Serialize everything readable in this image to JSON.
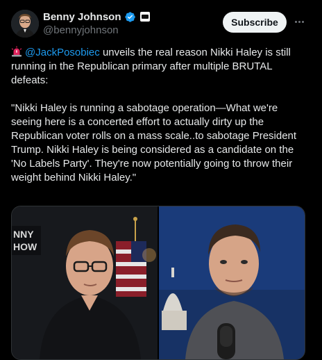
{
  "author": {
    "display_name": "Benny Johnson",
    "handle": "@bennyjohnson",
    "verified": true,
    "avatar_icon": "avatar-photo"
  },
  "header": {
    "subscribe_label": "Subscribe",
    "more_icon": "more-dots-icon"
  },
  "tweet": {
    "emoji_icon": "police-siren-emoji",
    "mention": "@JackPosobiec",
    "intro_rest": " unveils the real reason Nikki Haley is still running in the Republican primary after multiple BRUTAL defeats:",
    "quote": "\"Nikki Haley is running a sabotage operation—What we're seeing here is a concerted effort to actually dirty up the Republican voter rolls on a mass scale..to sabotage President Trump. Nikki Haley is being considered as a candidate on the 'No Labels Party'. They're now potentially going to throw their weight behind Nikki Haley.\""
  },
  "media": {
    "left_sign_text": "NNY\nHOW",
    "colors": {
      "accent": "#1d9bf0",
      "text": "#e7e9ea",
      "muted": "#71767b",
      "background": "#000000"
    }
  }
}
